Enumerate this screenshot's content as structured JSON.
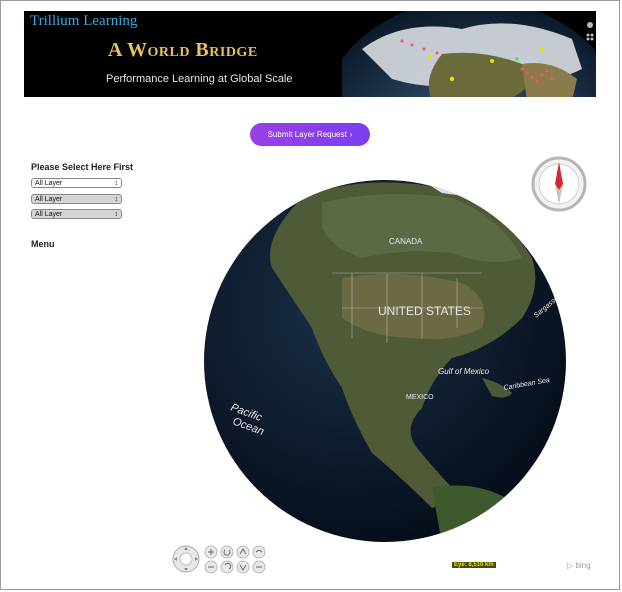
{
  "banner": {
    "brand": "Trillium Learning",
    "title": "A World Bridge",
    "subtitle": "Performance Learning at Global Scale"
  },
  "submit": {
    "label": "Submit Layer Request",
    "icon": "chevron-right-icon"
  },
  "layers": {
    "heading": "Please Select Here First",
    "selects": [
      {
        "value": "All Layer"
      },
      {
        "value": "All Layer"
      },
      {
        "value": "All Layer"
      }
    ]
  },
  "menu": {
    "label": "Menu"
  },
  "map": {
    "labels": {
      "canada": "CANADA",
      "usa": "UNITED STATES",
      "gulf": "Gulf of Mexico",
      "mexico": "MEXICO",
      "pacific_1": "Pacific",
      "pacific_2": "Ocean",
      "caribbean": "Caribbean Sea",
      "sargasso": "Sargasso"
    },
    "scale": "Eye: 8,510 km",
    "attribution": "bing"
  },
  "colors": {
    "banner_bg": "#000000",
    "brand": "#3fa6df",
    "title": "#e7c25a",
    "submit_bg": "#8a3fe8",
    "ocean": "#0c1a2c",
    "land": "#4f5a37"
  }
}
